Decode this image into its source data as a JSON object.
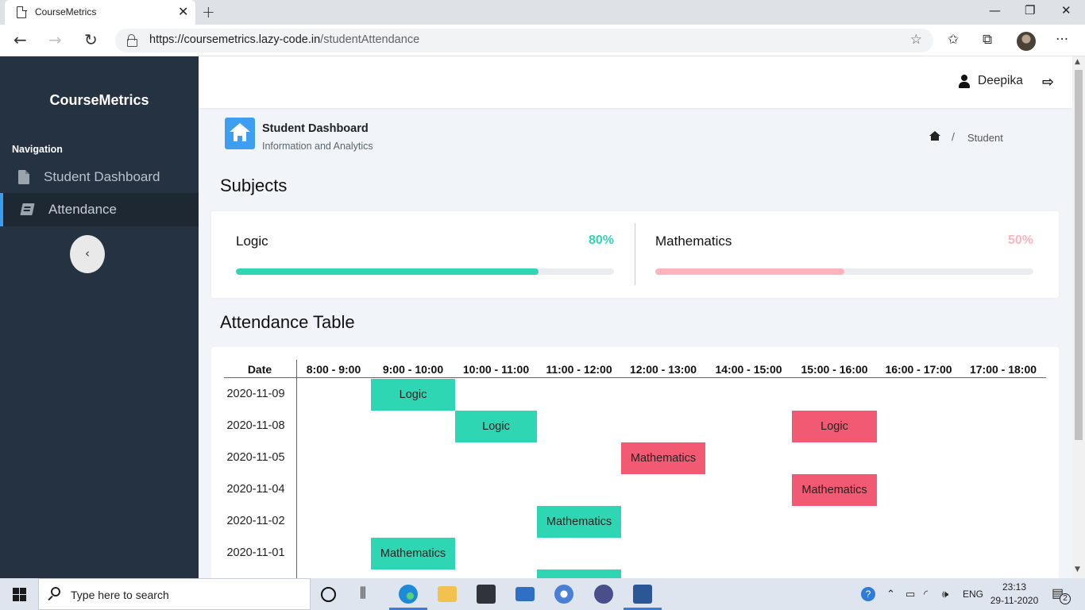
{
  "browser": {
    "tab_title": "CourseMetrics",
    "url_host": "https://coursemetrics.lazy-code.in",
    "url_path": "/studentAttendance"
  },
  "sidebar": {
    "brand": "CourseMetrics",
    "nav_heading": "Navigation",
    "items": [
      {
        "label": "Student Dashboard",
        "icon": "file-icon",
        "active": false
      },
      {
        "label": "Attendance",
        "icon": "book-icon",
        "active": true
      }
    ],
    "collapse_glyph": "‹"
  },
  "topbar": {
    "username": "Deepika"
  },
  "page": {
    "title": "Student Dashboard",
    "subtitle": "Information and Analytics",
    "breadcrumb_sep": "/",
    "breadcrumb_current": "Student"
  },
  "subjects": {
    "heading": "Subjects",
    "items": [
      {
        "name": "Logic",
        "percent_label": "80%",
        "progress": 0.8,
        "color": "#2fd6b4"
      },
      {
        "name": "Mathematics",
        "percent_label": "50%",
        "progress": 0.5,
        "color": "#ffb3bf"
      }
    ]
  },
  "attendance": {
    "heading": "Attendance Table",
    "date_header": "Date",
    "slots": [
      "8:00 - 9:00",
      "9:00 - 10:00",
      "10:00 - 11:00",
      "11:00 - 12:00",
      "12:00 - 13:00",
      "14:00 - 15:00",
      "15:00 - 16:00",
      "16:00 - 17:00",
      "17:00 - 18:00"
    ],
    "rows": [
      {
        "date": "2020-11-09",
        "entries": [
          {
            "slot": 1,
            "subject": "Logic",
            "status": "present"
          }
        ]
      },
      {
        "date": "2020-11-08",
        "entries": [
          {
            "slot": 2,
            "subject": "Logic",
            "status": "present"
          },
          {
            "slot": 6,
            "subject": "Logic",
            "status": "absent"
          }
        ]
      },
      {
        "date": "2020-11-05",
        "entries": [
          {
            "slot": 4,
            "subject": "Mathematics",
            "status": "absent"
          }
        ]
      },
      {
        "date": "2020-11-04",
        "entries": [
          {
            "slot": 6,
            "subject": "Mathematics",
            "status": "absent"
          }
        ]
      },
      {
        "date": "2020-11-02",
        "entries": [
          {
            "slot": 3,
            "subject": "Mathematics",
            "status": "present"
          }
        ]
      },
      {
        "date": "2020-11-01",
        "entries": [
          {
            "slot": 1,
            "subject": "Mathematics",
            "status": "present"
          }
        ]
      },
      {
        "date": "",
        "entries": [
          {
            "slot": 3,
            "subject": "",
            "status": "present"
          }
        ]
      }
    ],
    "colors": {
      "present": "#2fd6b4",
      "absent": "#f25973"
    }
  },
  "taskbar": {
    "search_placeholder": "Type here to search",
    "language": "ENG",
    "time": "23:13",
    "date": "29-11-2020",
    "notifications": "2"
  }
}
